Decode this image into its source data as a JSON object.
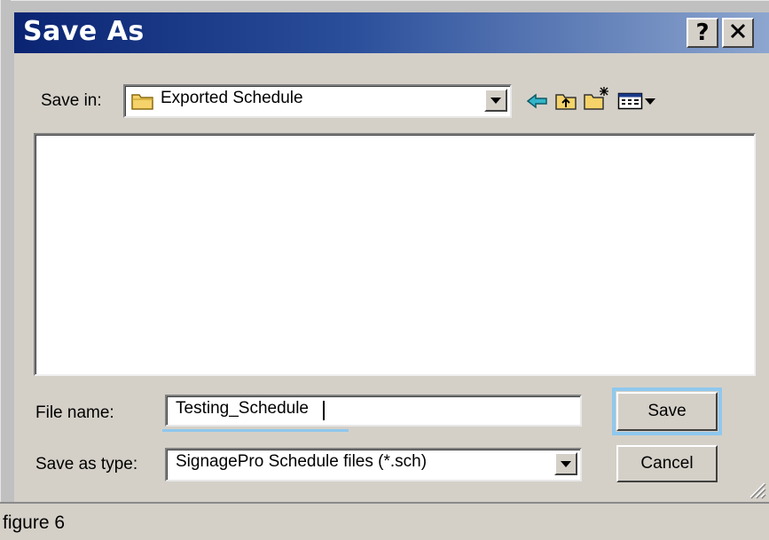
{
  "window": {
    "title": "Save As",
    "help_label": "?",
    "close_label": "✕"
  },
  "toolbar": {
    "save_in_label": "Save in:",
    "save_in_value": "Exported Schedule",
    "icons": [
      "folder-icon",
      "back-arrow-icon",
      "up-folder-icon",
      "new-folder-icon",
      "view-menu-icon"
    ]
  },
  "file_list": {
    "items": []
  },
  "form": {
    "file_name_label": "File name:",
    "file_name_value": "Testing_Schedule",
    "save_type_label": "Save as type:",
    "save_type_value": "SignagePro Schedule files (*.sch)"
  },
  "buttons": {
    "save_label": "Save",
    "cancel_label": "Cancel"
  },
  "caption": "figure 6",
  "colors": {
    "title_bar_start": "#0a2472",
    "title_bar_end": "#8da6cf",
    "dialog_face": "#d4d0c8",
    "focus_highlight": "#8fc8ee"
  }
}
